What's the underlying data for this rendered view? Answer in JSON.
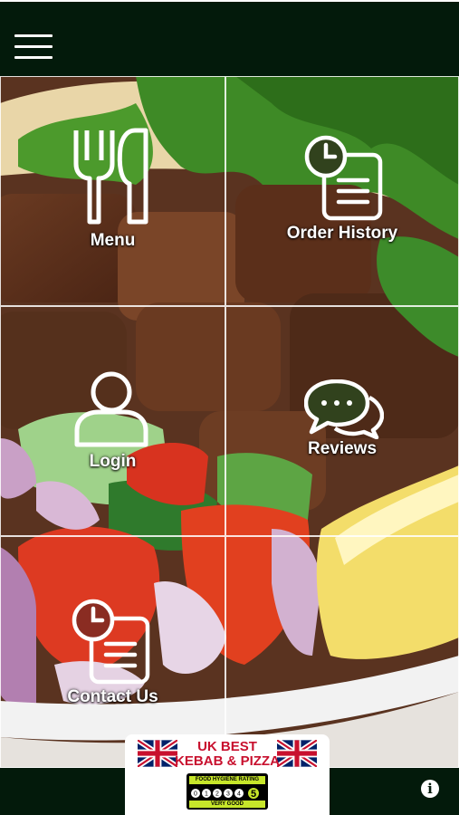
{
  "tiles": [
    {
      "id": "menu",
      "label": "Menu",
      "icon": "fork-knife-icon"
    },
    {
      "id": "order-history",
      "label": "Order History",
      "icon": "clock-document-icon"
    },
    {
      "id": "login",
      "label": "Login",
      "icon": "user-icon"
    },
    {
      "id": "reviews",
      "label": "Reviews",
      "icon": "speech-bubbles-icon"
    },
    {
      "id": "contact-us",
      "label": "Contact Us",
      "icon": "clock-document-icon"
    }
  ],
  "badge": {
    "title_line1": "UK BEST",
    "title_line2": "KEBAB & PIZZA",
    "rating_header": "FOOD HYGIENE RATING",
    "rating_value": "5",
    "rating_scale": [
      "0",
      "1",
      "2",
      "3",
      "4"
    ],
    "rating_text": "VERY GOOD"
  },
  "colors": {
    "bar": "#031a0b",
    "badge_red": "#c8102e",
    "rating_green": "#c7e62a"
  },
  "nav": {
    "menu_icon": "hamburger-icon",
    "info_icon": "info-icon"
  }
}
